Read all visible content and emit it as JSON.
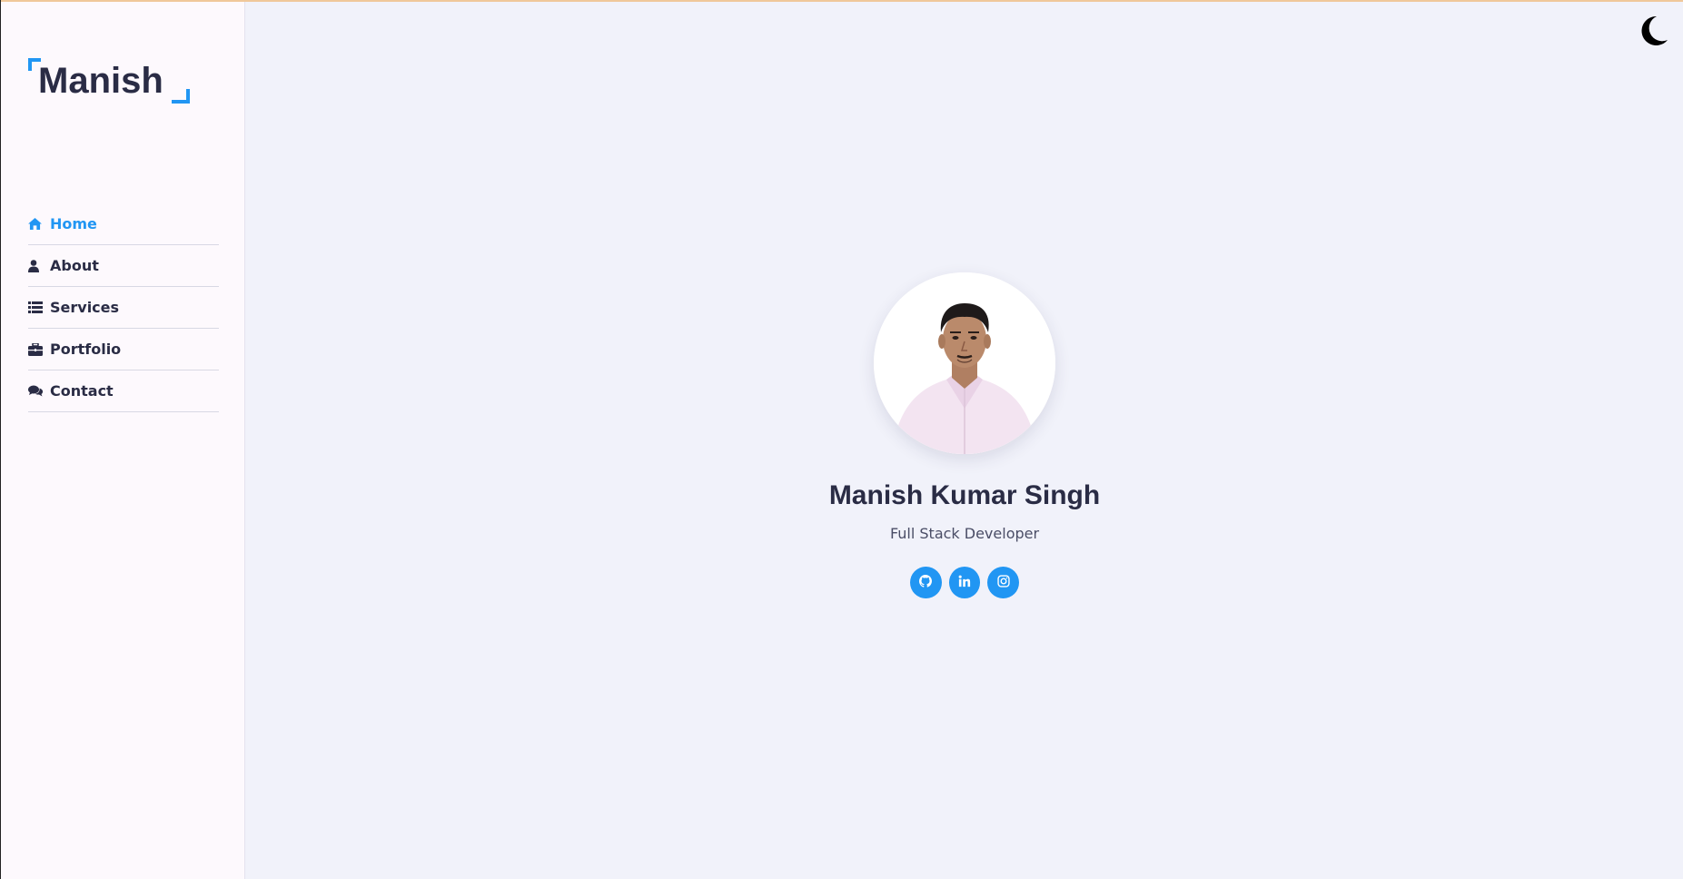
{
  "logo": {
    "text": "Manish"
  },
  "nav": {
    "items": [
      {
        "label": "Home",
        "icon": "home-icon",
        "active": true
      },
      {
        "label": "About",
        "icon": "user-icon",
        "active": false
      },
      {
        "label": "Services",
        "icon": "list-icon",
        "active": false
      },
      {
        "label": "Portfolio",
        "icon": "briefcase-icon",
        "active": false
      },
      {
        "label": "Contact",
        "icon": "comments-icon",
        "active": false
      }
    ]
  },
  "theme_toggle": {
    "icon": "moon-icon"
  },
  "hero": {
    "name": "Manish Kumar Singh",
    "role": "Full Stack Developer",
    "socials": [
      {
        "icon": "github-icon"
      },
      {
        "icon": "linkedin-icon"
      },
      {
        "icon": "instagram-icon"
      }
    ]
  },
  "colors": {
    "accent": "#2196f3",
    "text_dark": "#2a2c45",
    "sidebar_bg": "#fdf9fd",
    "main_bg": "#f1f2fa"
  }
}
